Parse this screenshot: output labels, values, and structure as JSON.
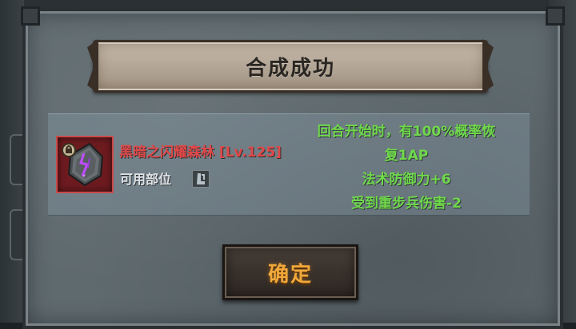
{
  "dialog": {
    "title": "合成成功"
  },
  "item": {
    "name": "黑暗之闪耀森林 [Lv.125]",
    "slot_label": "可用部位",
    "icon": "rune-stone-icon",
    "slot_icon": "boots-icon",
    "rarity_color": "#e04848"
  },
  "effects": [
    "回合开始时，有100%概率恢",
    "复1AP",
    "法术防御力+6",
    "受到重步兵伤害-2"
  ],
  "buttons": {
    "confirm": "确定"
  },
  "colors": {
    "effect_text": "#6fd94b",
    "confirm_text": "#f0a93a"
  }
}
